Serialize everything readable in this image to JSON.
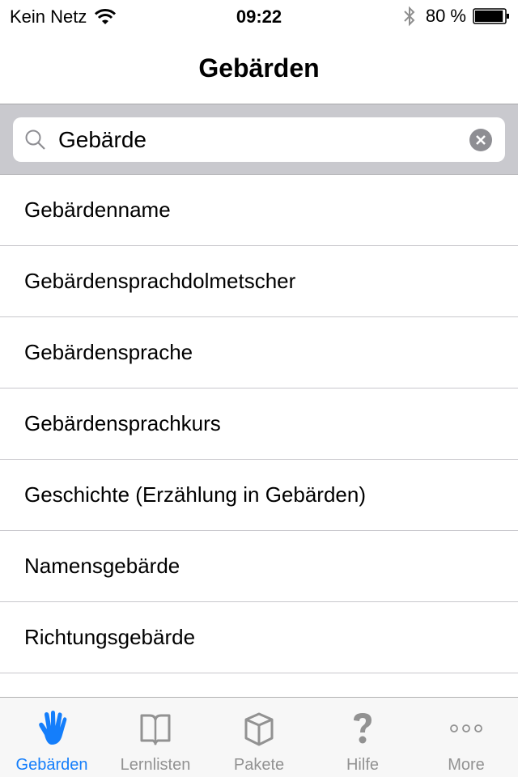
{
  "status_bar": {
    "carrier": "Kein Netz",
    "time": "09:22",
    "battery_text": "80 %",
    "battery_level": 0.8,
    "icons": [
      "wifi-icon",
      "bluetooth-icon",
      "battery-icon"
    ]
  },
  "nav": {
    "title": "Gebärden"
  },
  "search": {
    "value": "Gebärde",
    "placeholder": ""
  },
  "results": [
    {
      "label": "Gebärdenname"
    },
    {
      "label": "Gebärdensprachdolmetscher"
    },
    {
      "label": "Gebärdensprache"
    },
    {
      "label": "Gebärdensprachkurs"
    },
    {
      "label": "Geschichte (Erzählung in Gebärden)"
    },
    {
      "label": "Namensgebärde"
    },
    {
      "label": "Richtungsgebärde"
    }
  ],
  "tabs": [
    {
      "label": "Gebärden",
      "icon": "hand-icon",
      "active": true
    },
    {
      "label": "Lernlisten",
      "icon": "book-icon",
      "active": false
    },
    {
      "label": "Pakete",
      "icon": "box-icon",
      "active": false
    },
    {
      "label": "Hilfe",
      "icon": "question-icon",
      "active": false
    },
    {
      "label": "More",
      "icon": "more-dots-icon",
      "active": false
    }
  ],
  "colors": {
    "accent": "#147efb",
    "inactive_tab": "#929292",
    "search_bg": "#c9c9ce"
  }
}
